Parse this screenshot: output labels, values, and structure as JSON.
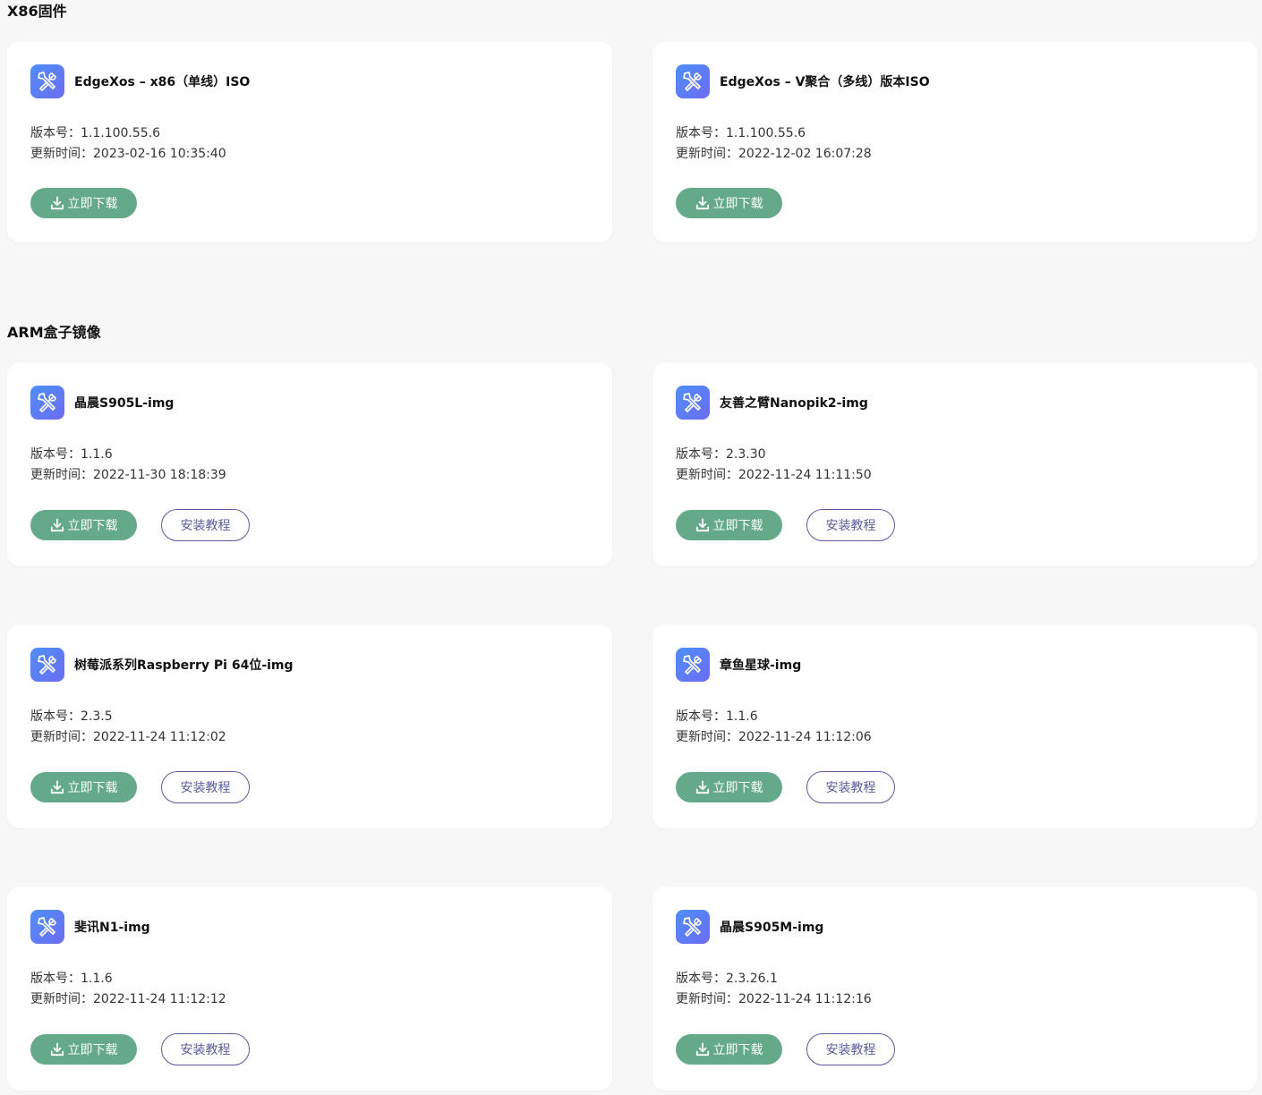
{
  "sections": [
    {
      "title": "X86固件"
    },
    {
      "title": "ARM盒子镜像"
    }
  ],
  "labels": {
    "version_prefix": "版本号：",
    "updated_prefix": "更新时间：",
    "download": "立即下载",
    "guide": "安装教程"
  },
  "colors": {
    "download_button": "#64a98a",
    "guide_border": "#5b5b9a",
    "icon_gradient_start": "#4d8ff7",
    "icon_gradient_end": "#6c6cf2"
  },
  "cards": [
    {
      "title": "EdgeXos – x86（单线）ISO",
      "version": "1.1.100.55.6",
      "updated": "2023-02-16 10:35:40",
      "icon": "tools-icon"
    },
    {
      "title": "EdgeXos – V聚合（多线）版本ISO",
      "version": "1.1.100.55.6",
      "updated": "2022-12-02 16:07:28",
      "icon": "tools-icon"
    },
    {
      "title": "晶晨S905L-img",
      "version": "1.1.6",
      "updated": "2022-11-30 18:18:39",
      "icon": "tools-icon"
    },
    {
      "title": "友善之臂Nanopik2-img",
      "version": "2.3.30",
      "updated": "2022-11-24 11:11:50",
      "icon": "tools-icon"
    },
    {
      "title": "树莓派系列Raspberry Pi 64位-img",
      "version": "2.3.5",
      "updated": "2022-11-24 11:12:02",
      "icon": "tools-icon"
    },
    {
      "title": "章鱼星球-img",
      "version": "1.1.6",
      "updated": "2022-11-24 11:12:06",
      "icon": "tools-icon"
    },
    {
      "title": "斐讯N1-img",
      "version": "1.1.6",
      "updated": "2022-11-24 11:12:12",
      "icon": "tools-icon"
    },
    {
      "title": "晶晨S905M-img",
      "version": "2.3.26.1",
      "updated": "2022-11-24 11:12:16",
      "icon": "tools-icon"
    }
  ]
}
